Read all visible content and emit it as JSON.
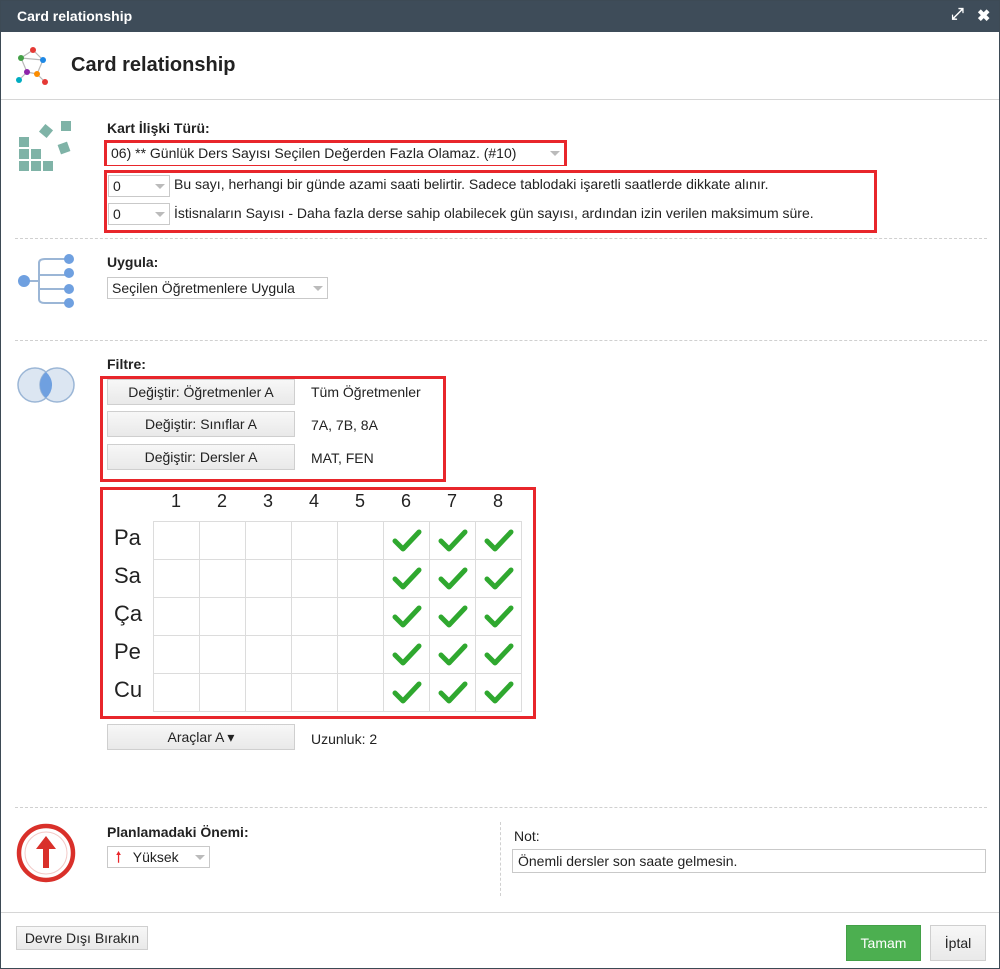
{
  "window": {
    "title": "Card relationship"
  },
  "header": {
    "title": "Card relationship"
  },
  "relation": {
    "label": "Kart İlişki Türü:",
    "selected": "06) ** Günlük Ders Sayısı Seçilen Değerden Fazla Olamaz. (#10)",
    "param1_value": "0",
    "param1_desc": "Bu sayı, herhangi bir günde azami saati belirtir. Sadece tablodaki işaretli saatlerde dikkate alınır.",
    "param2_value": "0",
    "param2_desc": "İstisnaların Sayısı - Daha fazla derse sahip olabilecek gün sayısı, ardından izin verilen maksimum süre."
  },
  "apply": {
    "label": "Uygula:",
    "selected": "Seçilen Öğretmenlere Uygula"
  },
  "filter": {
    "label": "Filtre:",
    "rows": [
      {
        "button": "Değiştir: Öğretmenler A",
        "value": "Tüm Öğretmenler"
      },
      {
        "button": "Değiştir: Sınıflar A",
        "value": "7A, 7B, 8A"
      },
      {
        "button": "Değiştir: Dersler A",
        "value": "MAT, FEN"
      }
    ]
  },
  "grid": {
    "columns": [
      "1",
      "2",
      "3",
      "4",
      "5",
      "6",
      "7",
      "8"
    ],
    "rows": [
      "Pa",
      "Sa",
      "Ça",
      "Pe",
      "Cu"
    ],
    "checked": [
      [
        false,
        false,
        false,
        false,
        false,
        true,
        true,
        true
      ],
      [
        false,
        false,
        false,
        false,
        false,
        true,
        true,
        true
      ],
      [
        false,
        false,
        false,
        false,
        false,
        true,
        true,
        true
      ],
      [
        false,
        false,
        false,
        false,
        false,
        true,
        true,
        true
      ],
      [
        false,
        false,
        false,
        false,
        false,
        true,
        true,
        true
      ]
    ],
    "check_color": "#2fa82f"
  },
  "tools": {
    "button": "Araçlar A ▾",
    "length": "Uzunluk: 2"
  },
  "importance": {
    "label": "Planlamadaki Önemi:",
    "selected": "Yüksek",
    "icon_color": "#d9302a"
  },
  "note": {
    "label": "Not:",
    "value": "Önemli dersler son saate gelmesin."
  },
  "footer": {
    "disable_button": "Devre Dışı Bırakın",
    "ok_button": "Tamam",
    "cancel_button": "İptal",
    "ok_color": "#4caf50"
  },
  "colors": {
    "highlight": "#e8262b",
    "titlebar": "#3e4c59"
  }
}
